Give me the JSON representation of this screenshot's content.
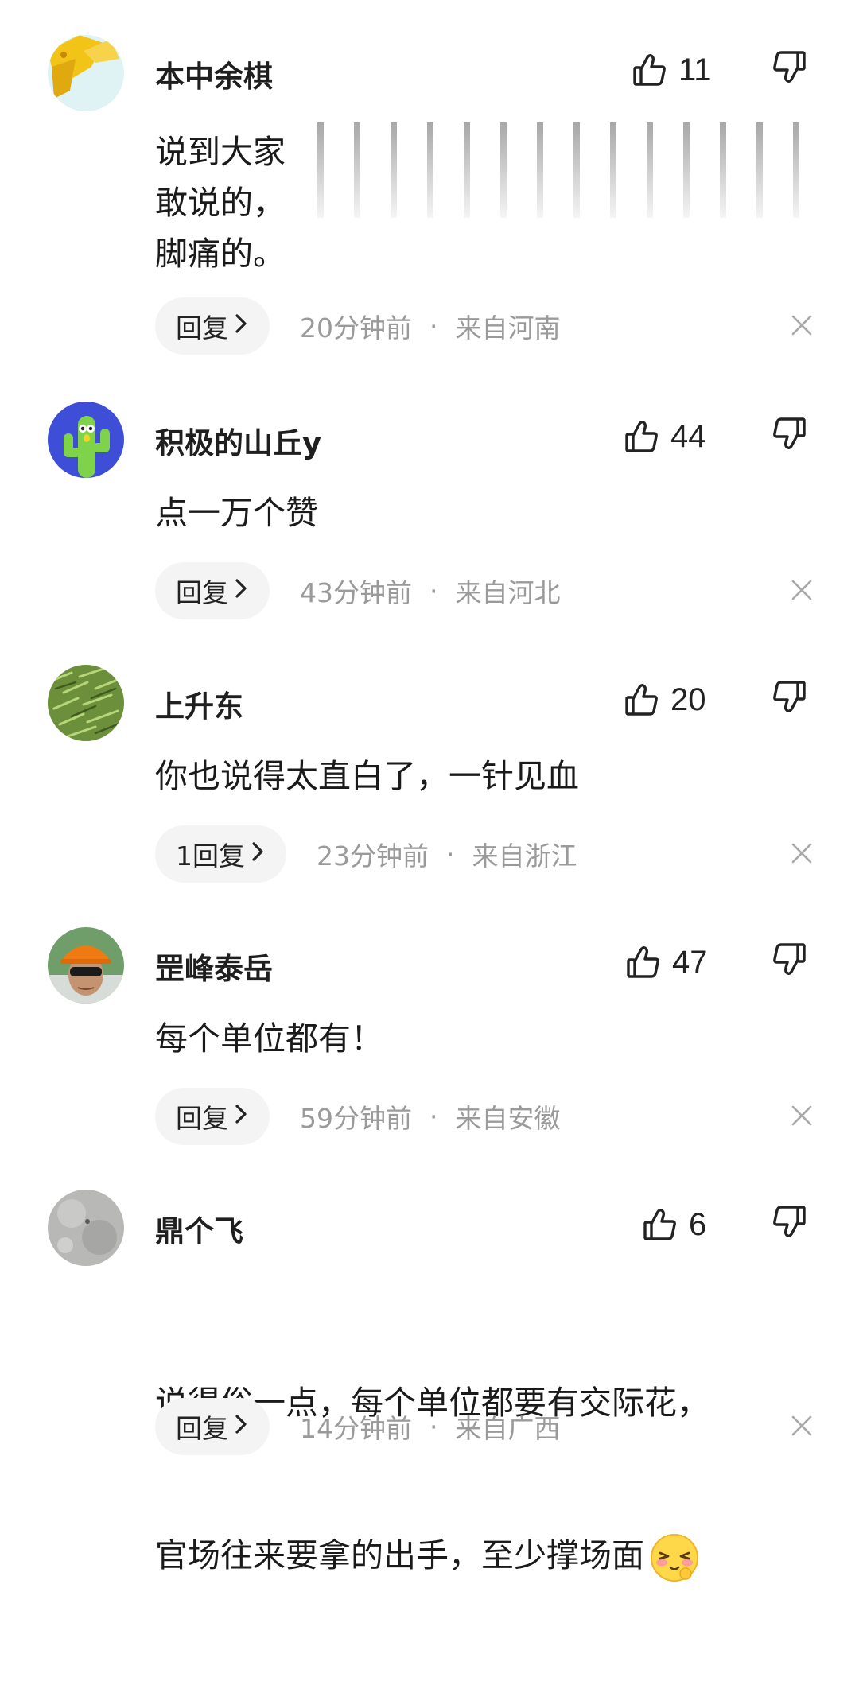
{
  "comments": [
    {
      "username": "本中余棋",
      "likes": "11",
      "text": "说到大家\n敢说的，\n脚痛的。",
      "reply_label": "回复",
      "time": "20分钟前",
      "location": "来自河南"
    },
    {
      "username": "积极的山丘y",
      "likes": "44",
      "text": "点一万个赞",
      "reply_label": "回复",
      "time": "43分钟前",
      "location": "来自河北"
    },
    {
      "username": "上升东",
      "likes": "20",
      "text": "你也说得太直白了，一针见血",
      "reply_label": "1回复",
      "time": "23分钟前",
      "location": "来自浙江"
    },
    {
      "username": "罡峰泰岳",
      "likes": "47",
      "text": "每个单位都有！",
      "reply_label": "回复",
      "time": "59分钟前",
      "location": "来自安徽"
    },
    {
      "username": "鼎个飞",
      "likes": "6",
      "text_line1": "说得俗一点，每个单位都要有交际花，",
      "text_line2": "官场往来要拿的出手，至少撑场面",
      "reply_label": "回复",
      "time": "14分钟前",
      "location": "来自广西"
    }
  ],
  "separator": "·",
  "icons": {
    "like": "thumbs-up-icon",
    "dislike": "thumbs-down-icon",
    "close": "close-icon",
    "reply_arrow": "chevron-right-icon",
    "emoji": "shy-face-emoji"
  },
  "colors": {
    "text": "#1a1a1a",
    "meta": "#9a9a9a",
    "reply_bg": "#f4f4f4"
  }
}
